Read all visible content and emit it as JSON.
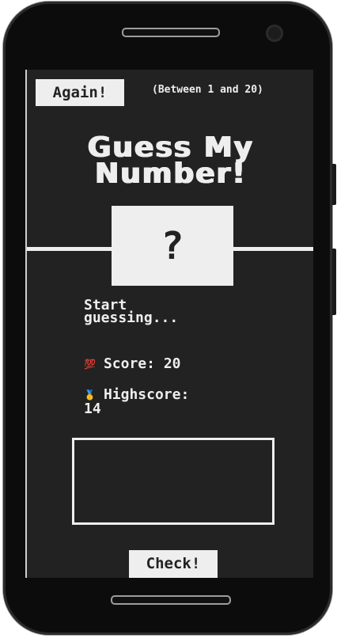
{
  "header": {
    "again_label": "Again!",
    "range_text": "(Between 1 and 20)"
  },
  "title": {
    "line1": "Guess My",
    "line2": "Number!"
  },
  "secret": {
    "display": "?"
  },
  "message": {
    "line1": "Start",
    "line2": "guessing..."
  },
  "score": {
    "icon": "💯",
    "label": "Score:",
    "value": "20"
  },
  "highscore": {
    "icon": "🥇",
    "label": "Highscore:",
    "value": "14"
  },
  "guess_input": {
    "value": ""
  },
  "check_label": "Check!",
  "colors": {
    "background": "#222222",
    "foreground": "#eeeeee",
    "phone_body": "#0c0c0c"
  }
}
